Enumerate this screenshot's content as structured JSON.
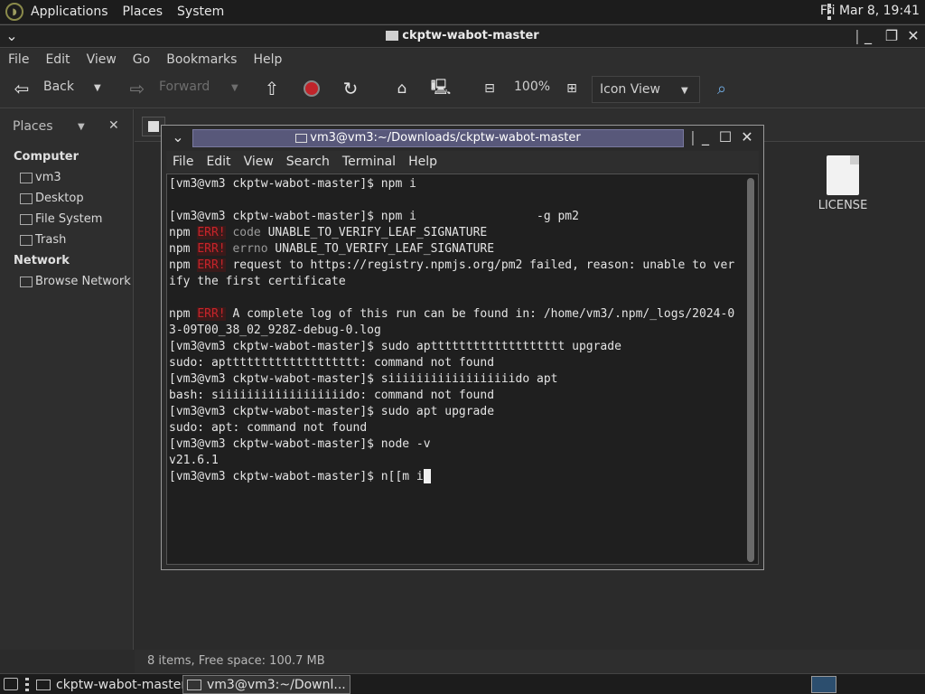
{
  "top_panel": {
    "menus": [
      "Applications",
      "Places",
      "System"
    ],
    "clock": "Fri Mar  8, 19:41"
  },
  "file_manager": {
    "title": "ckptw-wabot-master",
    "menubar": [
      "File",
      "Edit",
      "View",
      "Go",
      "Bookmarks",
      "Help"
    ],
    "toolbar": {
      "back": "Back",
      "forward": "Forward",
      "zoom": "100%",
      "view_mode": "Icon View"
    },
    "sidebar": {
      "header": "Places",
      "section_computer": "Computer",
      "computer_items": [
        "vm3",
        "Desktop",
        "File System",
        "Trash"
      ],
      "section_network": "Network",
      "network_items": [
        "Browse Network"
      ]
    },
    "files": [
      {
        "name": "LICENSE"
      }
    ],
    "status": "8 items, Free space: 100.7 MB"
  },
  "terminal": {
    "title": "vm3@vm3:~/Downloads/ckptw-wabot-master",
    "menubar": [
      "File",
      "Edit",
      "View",
      "Search",
      "Terminal",
      "Help"
    ],
    "lines": [
      "[vm3@vm3 ckptw-wabot-master]$ npm i",
      "",
      "[vm3@vm3 ckptw-wabot-master]$ npm i                 -g pm2",
      "npm ERR! code UNABLE_TO_VERIFY_LEAF_SIGNATURE",
      "npm ERR! errno UNABLE_TO_VERIFY_LEAF_SIGNATURE",
      "npm ERR! request to https://registry.npmjs.org/pm2 failed, reason: unable to ver",
      "ify the first certificate",
      "",
      "npm ERR! A complete log of this run can be found in: /home/vm3/.npm/_logs/2024-0",
      "3-09T00_38_02_928Z-debug-0.log",
      "[vm3@vm3 ckptw-wabot-master]$ sudo apttttttttttttttttttt upgrade",
      "sudo: apttttttttttttttttttt: command not found",
      "[vm3@vm3 ckptw-wabot-master]$ siiiiiiiiiiiiiiiiiido apt",
      "bash: siiiiiiiiiiiiiiiiiido: command not found",
      "[vm3@vm3 ckptw-wabot-master]$ sudo apt upgrade",
      "sudo: apt: command not found",
      "[vm3@vm3 ckptw-wabot-master]$ node -v",
      "v21.6.1",
      "[vm3@vm3 ckptw-wabot-master]$ n[[m i"
    ]
  },
  "taskbar": {
    "tasks": [
      "ckptw-wabot-master",
      "vm3@vm3:~/Downl..."
    ]
  },
  "colors": {
    "error_red": "#c8242a",
    "title_highlight": "#58587a"
  }
}
